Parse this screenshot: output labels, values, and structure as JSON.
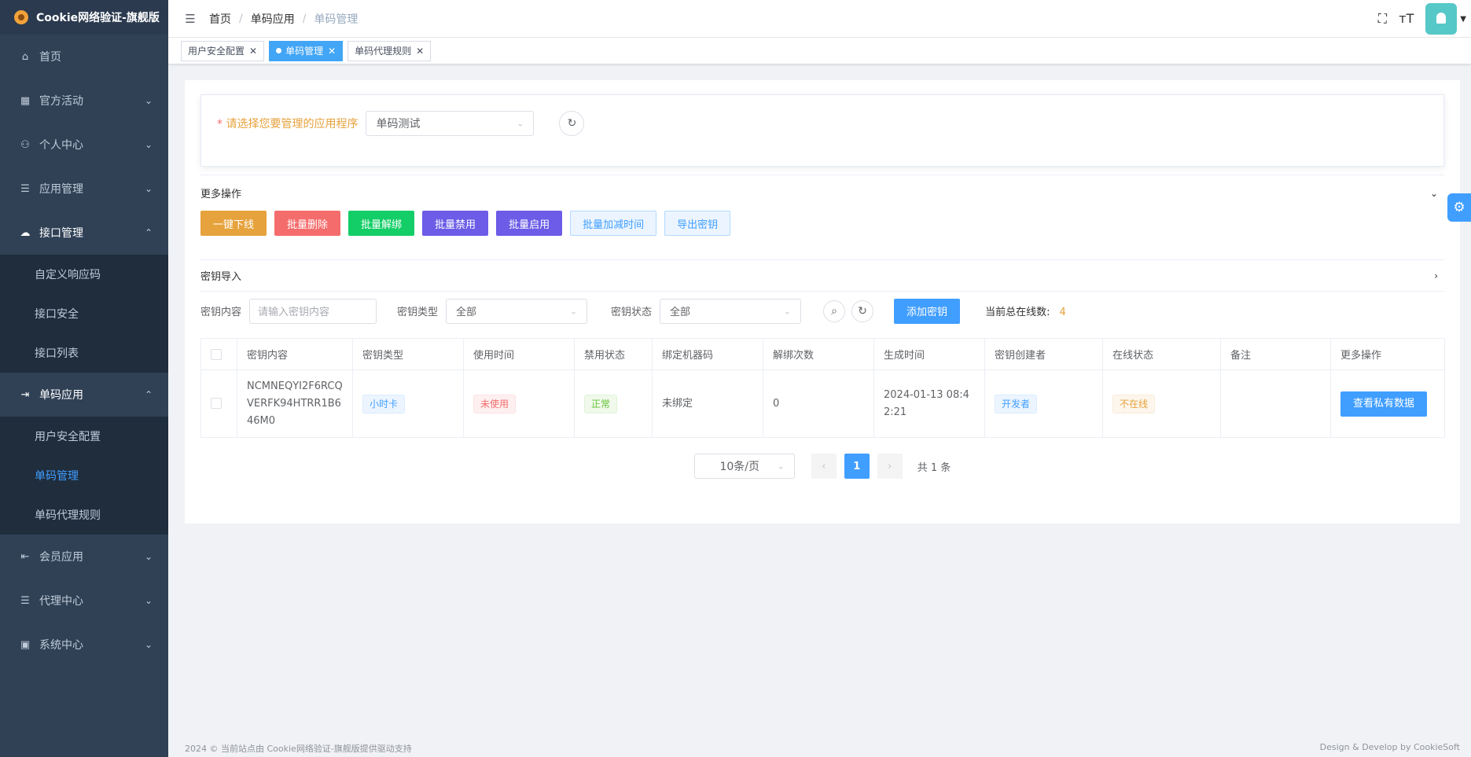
{
  "app": {
    "title": "Cookie网络验证-旗舰版"
  },
  "sidebar": {
    "items": [
      {
        "label": "首页",
        "icon": "home-icon"
      },
      {
        "label": "官方活动",
        "icon": "grid-icon"
      },
      {
        "label": "个人中心",
        "icon": "user-icon"
      },
      {
        "label": "应用管理",
        "icon": "tree-icon"
      },
      {
        "label": "接口管理",
        "icon": "cloud-icon",
        "children": [
          {
            "label": "自定义响应码"
          },
          {
            "label": "接口安全"
          },
          {
            "label": "接口列表"
          }
        ]
      },
      {
        "label": "单码应用",
        "icon": "login-icon",
        "children": [
          {
            "label": "用户安全配置"
          },
          {
            "label": "单码管理"
          },
          {
            "label": "单码代理规则"
          }
        ]
      },
      {
        "label": "会员应用",
        "icon": "logout-icon"
      },
      {
        "label": "代理中心",
        "icon": "tree-icon"
      },
      {
        "label": "系统中心",
        "icon": "system-icon"
      }
    ]
  },
  "header": {
    "breadcrumb": [
      "首页",
      "单码应用",
      "单码管理"
    ]
  },
  "tags": [
    {
      "label": "用户安全配置"
    },
    {
      "label": "单码管理"
    },
    {
      "label": "单码代理规则"
    }
  ],
  "selector": {
    "label": "请选择您要管理的应用程序",
    "value": "单码测试"
  },
  "more_ops": {
    "title": "更多操作",
    "buttons": [
      "一键下线",
      "批量删除",
      "批量解绑",
      "批量禁用",
      "批量启用",
      "批量加减时间",
      "导出密钥"
    ]
  },
  "import": {
    "title": "密钥导入"
  },
  "filter": {
    "content_label": "密钥内容",
    "content_placeholder": "请输入密钥内容",
    "type_label": "密钥类型",
    "type_value": "全部",
    "status_label": "密钥状态",
    "status_value": "全部",
    "add_button": "添加密钥",
    "online_label": "当前总在线数:",
    "online_count": "4"
  },
  "table": {
    "columns": [
      "密钥内容",
      "密钥类型",
      "使用时间",
      "禁用状态",
      "绑定机器码",
      "解绑次数",
      "生成时间",
      "密钥创建者",
      "在线状态",
      "备注",
      "更多操作"
    ],
    "rows": [
      {
        "content": "NCMNEQYI2F6RCQVERFK94HTRR1B646M0",
        "type": "小时卡",
        "use_time": "未使用",
        "ban_status": "正常",
        "machine": "未绑定",
        "unbind_count": "0",
        "created": "2024-01-13 08:42:21",
        "creator": "开发者",
        "online": "不在线",
        "remark": "",
        "action": "查看私有数据"
      }
    ]
  },
  "pager": {
    "page_size": "10条/页",
    "current": "1",
    "total": "共 1 条"
  },
  "footer": {
    "left": "2024 © 当前站点由 Cookie网络验证-旗舰版提供驱动支持",
    "right": "Design & Develop by CookieSoft"
  }
}
